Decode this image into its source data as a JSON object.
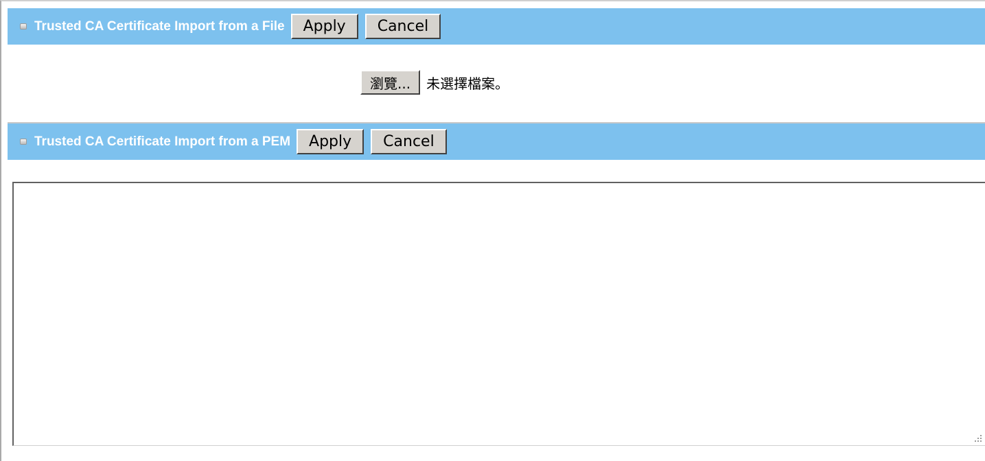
{
  "file_section": {
    "title": "Trusted CA Certificate Import from a File",
    "apply_label": "Apply",
    "cancel_label": "Cancel",
    "browse_label": "瀏覽...",
    "no_file_text": "未選擇檔案。"
  },
  "pem_section": {
    "title": "Trusted CA Certificate Import from a PEM",
    "apply_label": "Apply",
    "cancel_label": "Cancel",
    "textarea_value": ""
  },
  "colors": {
    "header_bg": "#7dc1ee",
    "header_text": "#ffffff",
    "button_face": "#d6d3ce"
  },
  "icons": {
    "section_bullet": "square-bullet-icon",
    "resize_grip": "resize-grip-icon"
  }
}
